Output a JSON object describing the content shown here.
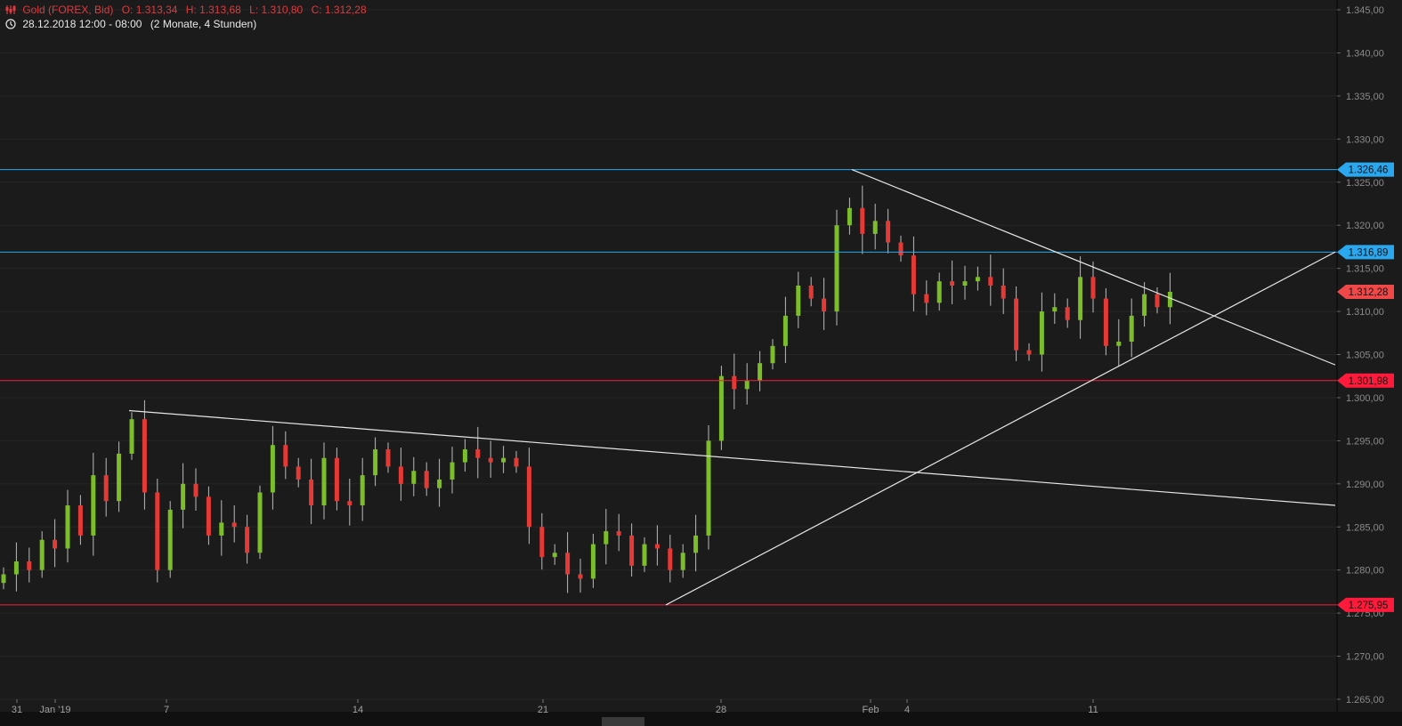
{
  "header": {
    "instrument": "Gold (FOREX, Bid)",
    "open": "O: 1.313,34",
    "high": "H: 1.313,68",
    "low": "L: 1.310,80",
    "close": "C: 1.312,28",
    "time_range": "28.12.2018 12:00 - 08:00",
    "period": "(2 Monate, 4 Stunden)"
  },
  "colors": {
    "up": "#7cbd2a",
    "down": "#e53935",
    "background": "#1b1b1b",
    "level_blue": "#29a8f0",
    "level_red": "#ff1a3c",
    "current_price": "#f04848",
    "trendline": "#e6e6e6"
  },
  "chart_data": {
    "type": "candlestick",
    "interval": "4 Stunden",
    "ylim": [
      1265,
      1345
    ],
    "y_ticks": [
      "1.345,00",
      "1.340,00",
      "1.335,00",
      "1.330,00",
      "1.325,00",
      "1.320,00",
      "1.315,00",
      "1.310,00",
      "1.305,00",
      "1.300,00",
      "1.295,00",
      "1.290,00",
      "1.285,00",
      "1.280,00",
      "1.275,00",
      "1.270,00",
      "1.265,00"
    ],
    "y_tick_values": [
      1345,
      1340,
      1335,
      1330,
      1325,
      1320,
      1315,
      1310,
      1305,
      1300,
      1295,
      1290,
      1285,
      1280,
      1275,
      1270,
      1265
    ],
    "x_ticks": [
      "31",
      "Jan '19",
      "7",
      "14",
      "21",
      "28",
      "Feb",
      "4",
      "11"
    ],
    "closes": [
      1279.5,
      1281.0,
      1280.0,
      1283.5,
      1282.5,
      1287.5,
      1284.0,
      1291.0,
      1288.0,
      1293.5,
      1297.5,
      1289.0,
      1280.0,
      1287.0,
      1290.0,
      1288.5,
      1284.0,
      1285.5,
      1285.0,
      1282.0,
      1289.0,
      1294.5,
      1292.0,
      1290.5,
      1287.5,
      1293.0,
      1288.0,
      1287.5,
      1291.0,
      1294.0,
      1292.0,
      1290.0,
      1291.5,
      1289.5,
      1290.5,
      1292.5,
      1294.0,
      1293.0,
      1292.5,
      1293.0,
      1292.0,
      1285.0,
      1281.5,
      1282.0,
      1279.5,
      1279.0,
      1283.0,
      1284.5,
      1284.0,
      1280.5,
      1283.0,
      1282.5,
      1280.0,
      1282.0,
      1284.0,
      1295.0,
      1302.5,
      1301.0,
      1302.0,
      1304.0,
      1306.0,
      1309.5,
      1313.0,
      1311.5,
      1310.0,
      1320.0,
      1322.0,
      1319.0,
      1320.5,
      1318.0,
      1316.5,
      1312.0,
      1311.0,
      1313.5,
      1313.0,
      1313.5,
      1314.0,
      1313.0,
      1311.5,
      1305.5,
      1305.0,
      1310.0,
      1310.5,
      1309.0,
      1314.0,
      1311.5,
      1306.0,
      1306.5,
      1309.5,
      1312.0,
      1310.5,
      1312.28
    ],
    "first_open": 1278.5,
    "levels": [
      {
        "price": 1326.46,
        "label": "1.326,46",
        "color": "blue"
      },
      {
        "price": 1316.89,
        "label": "1.316,89",
        "color": "blue"
      },
      {
        "price": 1301.98,
        "label": "1.301,98",
        "color": "red"
      },
      {
        "price": 1275.95,
        "label": "1.275,95",
        "color": "red"
      }
    ],
    "current_price": {
      "price": 1312.28,
      "label": "1.312,28"
    },
    "trendlines": [
      {
        "from_price": 1298.5,
        "to_price": 1287.5
      },
      {
        "from_price": 1275.95,
        "to_price": 1316.9
      },
      {
        "from_price": 1326.46,
        "to_price": 1303.8
      }
    ]
  }
}
